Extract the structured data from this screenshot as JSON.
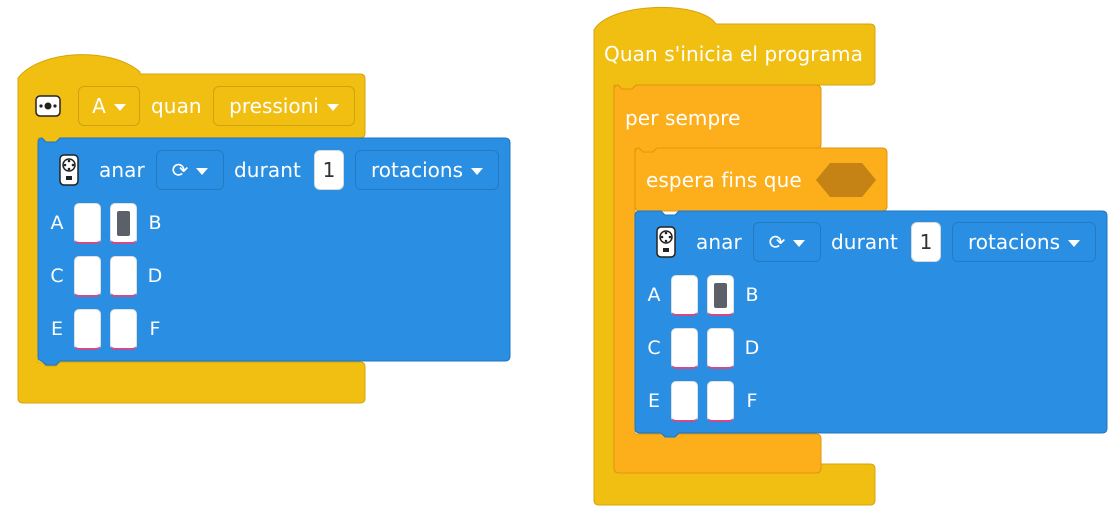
{
  "canvas": {
    "colors": {
      "event_yellow": "#f1be12",
      "event_yellow_dark": "#d7a40a",
      "control_orange": "#fcae1b",
      "control_orange_dark": "#e0950d",
      "motor_blue": "#2a8fe2",
      "motor_blue_dark": "#1f76c1",
      "condition_hex": "#c48314",
      "slot_active": "#5b6069"
    }
  },
  "left_script": {
    "hat_block": {
      "icon": "remote-button-icon",
      "button_select": "A",
      "when_label": "quan",
      "action_select": "pressioni"
    },
    "motor_block": {
      "icon": "multi-motor-icon",
      "go_label": "anar",
      "direction_icon": "clockwise-rotate-icon",
      "during_label": "durant",
      "amount": "1",
      "unit_select": "rotacions",
      "ports": [
        {
          "left": "A",
          "right": "B",
          "left_on": false,
          "right_on": true
        },
        {
          "left": "C",
          "right": "D",
          "left_on": false,
          "right_on": false
        },
        {
          "left": "E",
          "right": "F",
          "left_on": false,
          "right_on": false
        }
      ]
    }
  },
  "right_script": {
    "start_block": {
      "label": "Quan s'inicia el programa"
    },
    "forever_block": {
      "label": "per sempre"
    },
    "wait_block": {
      "label": "espera fins que",
      "condition_icon": "empty-condition-hexagon"
    },
    "motor_block": {
      "icon": "multi-motor-icon",
      "go_label": "anar",
      "direction_icon": "clockwise-rotate-icon",
      "during_label": "durant",
      "amount": "1",
      "unit_select": "rotacions",
      "ports": [
        {
          "left": "A",
          "right": "B",
          "left_on": false,
          "right_on": true
        },
        {
          "left": "C",
          "right": "D",
          "left_on": false,
          "right_on": false
        },
        {
          "left": "E",
          "right": "F",
          "left_on": false,
          "right_on": false
        }
      ]
    }
  }
}
